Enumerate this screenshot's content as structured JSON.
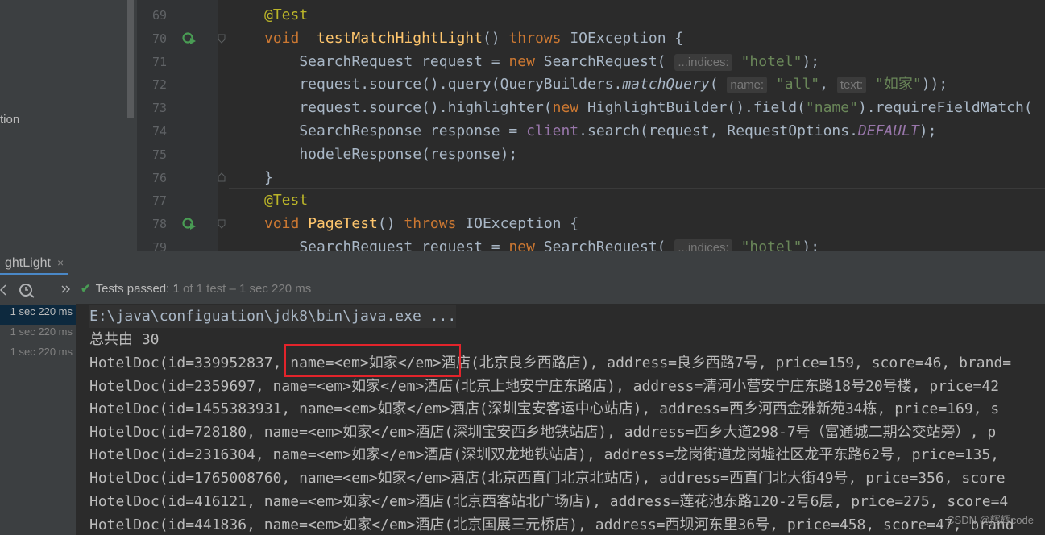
{
  "project_panel": {
    "partial_label": "tion"
  },
  "editor": {
    "lines": [
      {
        "num": "69",
        "parts": [
          {
            "t": "@Test",
            "c": "ann"
          }
        ]
      },
      {
        "num": "70",
        "parts": [
          {
            "t": "void",
            "c": "kw"
          },
          {
            "t": "  ",
            "c": ""
          },
          {
            "t": "testMatchHightLight",
            "c": "fn"
          },
          {
            "t": "() ",
            "c": ""
          },
          {
            "t": "throws",
            "c": "kw"
          },
          {
            "t": " IOException {",
            "c": ""
          }
        ]
      },
      {
        "num": "71",
        "parts": [
          {
            "t": "    SearchRequest request = ",
            "c": ""
          },
          {
            "t": "new",
            "c": "kw"
          },
          {
            "t": " SearchRequest( ",
            "c": ""
          },
          {
            "t": "...indices:",
            "c": "hint"
          },
          {
            "t": " ",
            "c": ""
          },
          {
            "t": "\"hotel\"",
            "c": "str"
          },
          {
            "t": ");",
            "c": ""
          }
        ]
      },
      {
        "num": "72",
        "parts": [
          {
            "t": "    request.source().query(QueryBuilders.",
            "c": ""
          },
          {
            "t": "matchQuery",
            "c": "ital"
          },
          {
            "t": "( ",
            "c": ""
          },
          {
            "t": "name:",
            "c": "hint"
          },
          {
            "t": " ",
            "c": ""
          },
          {
            "t": "\"all\"",
            "c": "str"
          },
          {
            "t": ", ",
            "c": ""
          },
          {
            "t": "text:",
            "c": "hint"
          },
          {
            "t": " ",
            "c": ""
          },
          {
            "t": "\"如家\"",
            "c": "str"
          },
          {
            "t": "));",
            "c": ""
          }
        ]
      },
      {
        "num": "73",
        "parts": [
          {
            "t": "    request.source().highlighter(",
            "c": ""
          },
          {
            "t": "new",
            "c": "kw"
          },
          {
            "t": " HighlightBuilder().field(",
            "c": ""
          },
          {
            "t": "\"name\"",
            "c": "str"
          },
          {
            "t": ").requireFieldMatch(",
            "c": ""
          }
        ]
      },
      {
        "num": "74",
        "parts": [
          {
            "t": "    SearchResponse response = ",
            "c": ""
          },
          {
            "t": "client",
            "c": "fld"
          },
          {
            "t": ".search(request, RequestOptions.",
            "c": ""
          },
          {
            "t": "DEFAULT",
            "c": "static"
          },
          {
            "t": ");",
            "c": ""
          }
        ]
      },
      {
        "num": "75",
        "parts": [
          {
            "t": "    hodeleResponse(response);",
            "c": ""
          }
        ]
      },
      {
        "num": "76",
        "parts": [
          {
            "t": "}",
            "c": ""
          }
        ]
      },
      {
        "num": "77",
        "parts": [
          {
            "t": "@Test",
            "c": "ann"
          }
        ]
      },
      {
        "num": "78",
        "parts": [
          {
            "t": "void",
            "c": "kw"
          },
          {
            "t": " ",
            "c": ""
          },
          {
            "t": "PageTest",
            "c": "fn"
          },
          {
            "t": "() ",
            "c": ""
          },
          {
            "t": "throws",
            "c": "kw"
          },
          {
            "t": " IOException {",
            "c": ""
          }
        ]
      },
      {
        "num": "79",
        "parts": [
          {
            "t": "    SearchRequest request = ",
            "c": ""
          },
          {
            "t": "new",
            "c": "kw"
          },
          {
            "t": " SearchRequest( ",
            "c": ""
          },
          {
            "t": "...indices:",
            "c": "hint"
          },
          {
            "t": " ",
            "c": ""
          },
          {
            "t": "\"hotel\"",
            "c": "str"
          },
          {
            "t": ");",
            "c": ""
          }
        ]
      }
    ]
  },
  "run_panel": {
    "tab_label": "ghtLight",
    "tab_close": "×",
    "status_check": "✔",
    "status_label": "Tests passed:",
    "status_count": " 1",
    "status_detail": " of 1 test – 1 sec 220 ms",
    "tree_items": [
      "1 sec 220 ms",
      "1 sec 220 ms",
      "1 sec 220 ms"
    ],
    "console_lines": [
      "E:\\java\\configuation\\jdk8\\bin\\java.exe ...",
      "总共由 30",
      "HotelDoc(id=339952837, name=<em>如家</em>酒店(北京良乡西路店), address=良乡西路7号, price=159, score=46, brand=",
      "HotelDoc(id=2359697, name=<em>如家</em>酒店(北京上地安宁庄东路店), address=清河小营安宁庄东路18号20号楼, price=42",
      "HotelDoc(id=1455383931, name=<em>如家</em>酒店(深圳宝安客运中心站店), address=西乡河西金雅新苑34栋, price=169, s",
      "HotelDoc(id=728180, name=<em>如家</em>酒店(深圳宝安西乡地铁站店), address=西乡大道298-7号（富通城二期公交站旁）, p",
      "HotelDoc(id=2316304, name=<em>如家</em>酒店(深圳双龙地铁站店), address=龙岗街道龙岗墟社区龙平东路62号, price=135,",
      "HotelDoc(id=1765008760, name=<em>如家</em>酒店(北京西直门北京北站店), address=西直门北大街49号, price=356, score",
      "HotelDoc(id=416121, name=<em>如家</em>酒店(北京西客站北广场店), address=莲花池东路120-2号6层, price=275, score=4",
      "HotelDoc(id=441836, name=<em>如家</em>酒店(北京国展三元桥店), address=西坝河东里36号, price=458, score=47, brand"
    ]
  },
  "watermark": "CSDN @辉辉code"
}
